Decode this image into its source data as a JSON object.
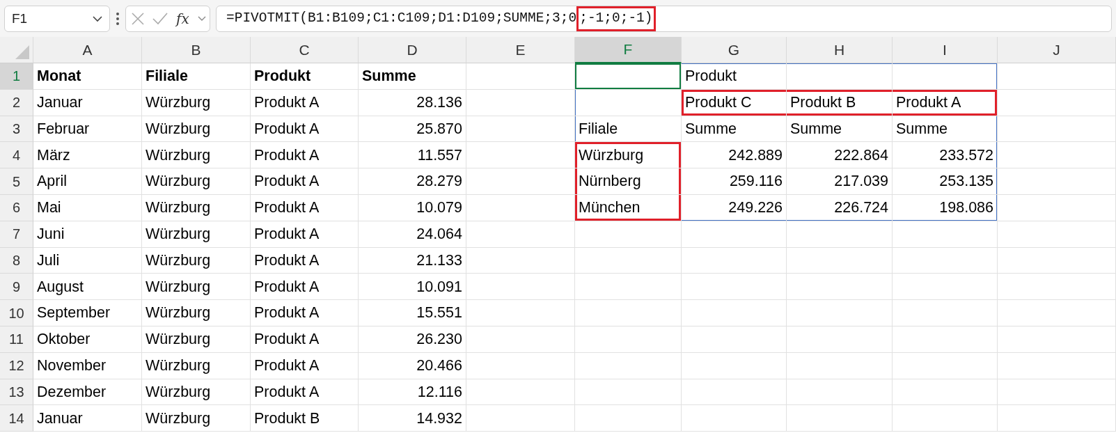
{
  "formula_bar": {
    "name_box": "F1",
    "function_label": "fx",
    "formula_parts": [
      {
        "text": "=PIVOTMIT(B1:B109;C1:C109;D1:D109;SUMME;3;0",
        "highlighted": false
      },
      {
        "text": ";-1;0;-1)",
        "highlighted": true
      }
    ]
  },
  "columns": [
    "A",
    "B",
    "C",
    "D",
    "E",
    "F",
    "G",
    "H",
    "I",
    "J"
  ],
  "rows": [
    {
      "number": "1",
      "cells": [
        {
          "text": "Monat",
          "kind": "header"
        },
        {
          "text": "Filiale",
          "kind": "header"
        },
        {
          "text": "Produkt",
          "kind": "header"
        },
        {
          "text": "Summe",
          "kind": "header"
        },
        {
          "kind": "empty"
        },
        {
          "kind": "empty",
          "active": true,
          "spill": true
        },
        {
          "text": "Produkt",
          "kind": "text",
          "spill": true
        },
        {
          "kind": "empty",
          "spill": true
        },
        {
          "kind": "empty",
          "spill": true
        },
        {
          "kind": "empty"
        }
      ]
    },
    {
      "number": "2",
      "cells": [
        {
          "text": "Januar",
          "kind": "text"
        },
        {
          "text": "Würzburg",
          "kind": "text"
        },
        {
          "text": "Produkt A",
          "kind": "text"
        },
        {
          "text": "28.136",
          "kind": "number"
        },
        {
          "kind": "empty"
        },
        {
          "kind": "empty",
          "spill": true
        },
        {
          "text": "Produkt C",
          "kind": "text",
          "spill": true,
          "framed": true
        },
        {
          "text": "Produkt B",
          "kind": "text",
          "spill": true,
          "framed": true
        },
        {
          "text": "Produkt A",
          "kind": "text",
          "spill": true,
          "framed": true
        },
        {
          "kind": "empty"
        }
      ]
    },
    {
      "number": "3",
      "cells": [
        {
          "text": "Februar",
          "kind": "text"
        },
        {
          "text": "Würzburg",
          "kind": "text"
        },
        {
          "text": "Produkt A",
          "kind": "text"
        },
        {
          "text": "25.870",
          "kind": "number"
        },
        {
          "kind": "empty"
        },
        {
          "text": "Filiale",
          "kind": "text",
          "spill": true
        },
        {
          "text": "Summe",
          "kind": "text",
          "spill": true
        },
        {
          "text": "Summe",
          "kind": "text",
          "spill": true
        },
        {
          "text": "Summe",
          "kind": "text",
          "spill": true
        },
        {
          "kind": "empty"
        }
      ]
    },
    {
      "number": "4",
      "cells": [
        {
          "text": "März",
          "kind": "text"
        },
        {
          "text": "Würzburg",
          "kind": "text"
        },
        {
          "text": "Produkt A",
          "kind": "text"
        },
        {
          "text": "11.557",
          "kind": "number"
        },
        {
          "kind": "empty"
        },
        {
          "text": "Würzburg",
          "kind": "text",
          "spill": true,
          "framed": true
        },
        {
          "text": "242.889",
          "kind": "number",
          "spill": true
        },
        {
          "text": "222.864",
          "kind": "number",
          "spill": true
        },
        {
          "text": "233.572",
          "kind": "number",
          "spill": true
        },
        {
          "kind": "empty"
        }
      ]
    },
    {
      "number": "5",
      "cells": [
        {
          "text": "April",
          "kind": "text"
        },
        {
          "text": "Würzburg",
          "kind": "text"
        },
        {
          "text": "Produkt A",
          "kind": "text"
        },
        {
          "text": "28.279",
          "kind": "number"
        },
        {
          "kind": "empty"
        },
        {
          "text": "Nürnberg",
          "kind": "text",
          "spill": true,
          "framed": true
        },
        {
          "text": "259.116",
          "kind": "number",
          "spill": true
        },
        {
          "text": "217.039",
          "kind": "number",
          "spill": true
        },
        {
          "text": "253.135",
          "kind": "number",
          "spill": true
        },
        {
          "kind": "empty"
        }
      ]
    },
    {
      "number": "6",
      "cells": [
        {
          "text": "Mai",
          "kind": "text"
        },
        {
          "text": "Würzburg",
          "kind": "text"
        },
        {
          "text": "Produkt A",
          "kind": "text"
        },
        {
          "text": "10.079",
          "kind": "number"
        },
        {
          "kind": "empty"
        },
        {
          "text": "München",
          "kind": "text",
          "spill": true,
          "framed": true
        },
        {
          "text": "249.226",
          "kind": "number",
          "spill": true
        },
        {
          "text": "226.724",
          "kind": "number",
          "spill": true
        },
        {
          "text": "198.086",
          "kind": "number",
          "spill": true
        },
        {
          "kind": "empty"
        }
      ]
    },
    {
      "number": "7",
      "cells": [
        {
          "text": "Juni",
          "kind": "text"
        },
        {
          "text": "Würzburg",
          "kind": "text"
        },
        {
          "text": "Produkt A",
          "kind": "text"
        },
        {
          "text": "24.064",
          "kind": "number"
        },
        {
          "kind": "empty"
        },
        {
          "kind": "empty"
        },
        {
          "kind": "empty"
        },
        {
          "kind": "empty"
        },
        {
          "kind": "empty"
        },
        {
          "kind": "empty"
        }
      ]
    },
    {
      "number": "8",
      "cells": [
        {
          "text": "Juli",
          "kind": "text"
        },
        {
          "text": "Würzburg",
          "kind": "text"
        },
        {
          "text": "Produkt A",
          "kind": "text"
        },
        {
          "text": "21.133",
          "kind": "number"
        },
        {
          "kind": "empty"
        },
        {
          "kind": "empty"
        },
        {
          "kind": "empty"
        },
        {
          "kind": "empty"
        },
        {
          "kind": "empty"
        },
        {
          "kind": "empty"
        }
      ]
    },
    {
      "number": "9",
      "cells": [
        {
          "text": "August",
          "kind": "text"
        },
        {
          "text": "Würzburg",
          "kind": "text"
        },
        {
          "text": "Produkt A",
          "kind": "text"
        },
        {
          "text": "10.091",
          "kind": "number"
        },
        {
          "kind": "empty"
        },
        {
          "kind": "empty"
        },
        {
          "kind": "empty"
        },
        {
          "kind": "empty"
        },
        {
          "kind": "empty"
        },
        {
          "kind": "empty"
        }
      ]
    },
    {
      "number": "10",
      "cells": [
        {
          "text": "September",
          "kind": "text"
        },
        {
          "text": "Würzburg",
          "kind": "text"
        },
        {
          "text": "Produkt A",
          "kind": "text"
        },
        {
          "text": "15.551",
          "kind": "number"
        },
        {
          "kind": "empty"
        },
        {
          "kind": "empty"
        },
        {
          "kind": "empty"
        },
        {
          "kind": "empty"
        },
        {
          "kind": "empty"
        },
        {
          "kind": "empty"
        }
      ]
    },
    {
      "number": "11",
      "cells": [
        {
          "text": "Oktober",
          "kind": "text"
        },
        {
          "text": "Würzburg",
          "kind": "text"
        },
        {
          "text": "Produkt A",
          "kind": "text"
        },
        {
          "text": "26.230",
          "kind": "number"
        },
        {
          "kind": "empty"
        },
        {
          "kind": "empty"
        },
        {
          "kind": "empty"
        },
        {
          "kind": "empty"
        },
        {
          "kind": "empty"
        },
        {
          "kind": "empty"
        }
      ]
    },
    {
      "number": "12",
      "cells": [
        {
          "text": "November",
          "kind": "text"
        },
        {
          "text": "Würzburg",
          "kind": "text"
        },
        {
          "text": "Produkt A",
          "kind": "text"
        },
        {
          "text": "20.466",
          "kind": "number"
        },
        {
          "kind": "empty"
        },
        {
          "kind": "empty"
        },
        {
          "kind": "empty"
        },
        {
          "kind": "empty"
        },
        {
          "kind": "empty"
        },
        {
          "kind": "empty"
        }
      ]
    },
    {
      "number": "13",
      "cells": [
        {
          "text": "Dezember",
          "kind": "text"
        },
        {
          "text": "Würzburg",
          "kind": "text"
        },
        {
          "text": "Produkt A",
          "kind": "text"
        },
        {
          "text": "12.116",
          "kind": "number"
        },
        {
          "kind": "empty"
        },
        {
          "kind": "empty"
        },
        {
          "kind": "empty"
        },
        {
          "kind": "empty"
        },
        {
          "kind": "empty"
        },
        {
          "kind": "empty"
        }
      ]
    },
    {
      "number": "14",
      "cells": [
        {
          "text": "Januar",
          "kind": "text"
        },
        {
          "text": "Würzburg",
          "kind": "text"
        },
        {
          "text": "Produkt B",
          "kind": "text"
        },
        {
          "text": "14.932",
          "kind": "number"
        },
        {
          "kind": "empty"
        },
        {
          "kind": "empty"
        },
        {
          "kind": "empty"
        },
        {
          "kind": "empty"
        },
        {
          "kind": "empty"
        },
        {
          "kind": "empty"
        }
      ]
    }
  ]
}
